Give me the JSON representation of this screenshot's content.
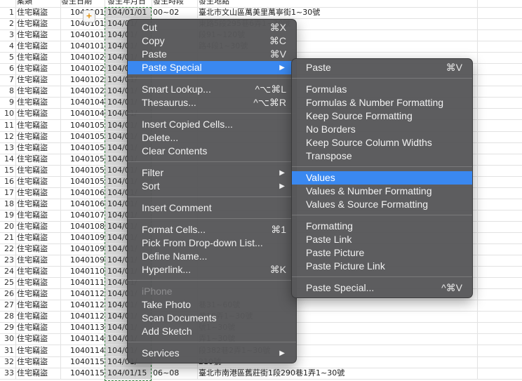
{
  "sheet": {
    "headers": [
      "案類",
      "發生日期",
      "發生年月日",
      "發生時段",
      "發生地點"
    ],
    "rows": [
      {
        "n": "1",
        "cat": "住宅竊盜",
        "date": "1040101",
        "ymd": "104/01/01",
        "time": "00~02",
        "addr": "臺北市文山區萬美里萬寧街1~30號"
      },
      {
        "n": "2",
        "cat": "住宅竊盜",
        "date": "1040101",
        "ymd": "104/01/",
        "time": "",
        "addr": "東路5段295巷6弄1~30號"
      },
      {
        "n": "3",
        "cat": "住宅竊盜",
        "date": "1040101",
        "ymd": "104/01/",
        "time": "",
        "addr": "段91~120號"
      },
      {
        "n": "4",
        "cat": "住宅竊盜",
        "date": "1040101",
        "ymd": "104/01/",
        "time": "",
        "addr": "路4段1~30號"
      },
      {
        "n": "5",
        "cat": "住宅竊盜",
        "date": "1040102",
        "ymd": "104/01/",
        "time": "",
        "addr": ""
      },
      {
        "n": "6",
        "cat": "住宅竊盜",
        "date": "1040102",
        "ymd": "104/01/",
        "time": "",
        "addr": ""
      },
      {
        "n": "7",
        "cat": "住宅竊盜",
        "date": "1040102",
        "ymd": "104/01/",
        "time": "",
        "addr": ""
      },
      {
        "n": "8",
        "cat": "住宅竊盜",
        "date": "1040102",
        "ymd": "104/01/",
        "time": "",
        "addr": ""
      },
      {
        "n": "9",
        "cat": "住宅竊盜",
        "date": "1040104",
        "ymd": "104/01/",
        "time": "",
        "addr": ""
      },
      {
        "n": "10",
        "cat": "住宅竊盜",
        "date": "1040104",
        "ymd": "104/01/",
        "time": "",
        "addr": ""
      },
      {
        "n": "11",
        "cat": "住宅竊盜",
        "date": "1040105",
        "ymd": "104/01/",
        "time": "",
        "addr": ""
      },
      {
        "n": "12",
        "cat": "住宅竊盜",
        "date": "1040105",
        "ymd": "104/01/",
        "time": "",
        "addr": ""
      },
      {
        "n": "13",
        "cat": "住宅竊盜",
        "date": "1040105",
        "ymd": "104/01/",
        "time": "",
        "addr": ""
      },
      {
        "n": "14",
        "cat": "住宅竊盜",
        "date": "1040105",
        "ymd": "104/01/",
        "time": "",
        "addr": ""
      },
      {
        "n": "15",
        "cat": "住宅竊盜",
        "date": "1040105",
        "ymd": "104/01/",
        "time": "",
        "addr": ""
      },
      {
        "n": "16",
        "cat": "住宅竊盜",
        "date": "1040105",
        "ymd": "104/01/",
        "time": "",
        "addr": ""
      },
      {
        "n": "17",
        "cat": "住宅竊盜",
        "date": "1040106",
        "ymd": "104/01/",
        "time": "",
        "addr": ""
      },
      {
        "n": "18",
        "cat": "住宅竊盜",
        "date": "1040106",
        "ymd": "104/01/",
        "time": "",
        "addr": ""
      },
      {
        "n": "19",
        "cat": "住宅竊盜",
        "date": "1040107",
        "ymd": "104/01/",
        "time": "",
        "addr": ""
      },
      {
        "n": "20",
        "cat": "住宅竊盜",
        "date": "1040108",
        "ymd": "104/01/",
        "time": "",
        "addr": ""
      },
      {
        "n": "21",
        "cat": "住宅竊盜",
        "date": "1040109",
        "ymd": "104/01/",
        "time": "",
        "addr": ""
      },
      {
        "n": "22",
        "cat": "住宅竊盜",
        "date": "1040109",
        "ymd": "104/01/",
        "time": "",
        "addr": ""
      },
      {
        "n": "23",
        "cat": "住宅竊盜",
        "date": "1040109",
        "ymd": "104/01/",
        "time": "",
        "addr": ""
      },
      {
        "n": "24",
        "cat": "住宅竊盜",
        "date": "1040110",
        "ymd": "104/01/",
        "time": "",
        "addr": ""
      },
      {
        "n": "25",
        "cat": "住宅竊盜",
        "date": "1040111",
        "ymd": "104/01/",
        "time": "",
        "addr": ""
      },
      {
        "n": "26",
        "cat": "住宅竊盜",
        "date": "1040112",
        "ymd": "104/01/",
        "time": "",
        "addr": ""
      },
      {
        "n": "27",
        "cat": "住宅竊盜",
        "date": "1040112",
        "ymd": "104/01/",
        "time": "",
        "addr": "巷31~60號"
      },
      {
        "n": "28",
        "cat": "住宅竊盜",
        "date": "1040112",
        "ymd": "104/01/",
        "time": "",
        "addr": "巷18弄1~30號"
      },
      {
        "n": "29",
        "cat": "住宅竊盜",
        "date": "1040113",
        "ymd": "104/01/",
        "time": "",
        "addr": "號1~30號"
      },
      {
        "n": "30",
        "cat": "住宅竊盜",
        "date": "1040114",
        "ymd": "104/01/",
        "time": "",
        "addr": "弄1~30號"
      },
      {
        "n": "31",
        "cat": "住宅竊盜",
        "date": "1040114",
        "ymd": "104/01/",
        "time": "",
        "addr": "段382巷2弄1~30號"
      },
      {
        "n": "32",
        "cat": "住宅竊盜",
        "date": "1040115",
        "ymd": "104/01/",
        "time": "",
        "addr": "210號"
      },
      {
        "n": "33",
        "cat": "住宅竊盜",
        "date": "1040115",
        "ymd": "104/01/15",
        "time": "06~08",
        "addr": "臺北市南港區舊莊街1段290巷1弄1~30號"
      }
    ]
  },
  "context_menu": {
    "items": [
      {
        "label": "Cut",
        "shortcut": "⌘X"
      },
      {
        "label": "Copy",
        "shortcut": "⌘C"
      },
      {
        "label": "Paste",
        "shortcut": "⌘V"
      },
      {
        "label": "Paste Special",
        "arrow": "▶",
        "highlighted": true
      },
      {
        "separator": true
      },
      {
        "label": "Smart Lookup...",
        "shortcut": "^⌥⌘L"
      },
      {
        "label": "Thesaurus...",
        "shortcut": "^⌥⌘R"
      },
      {
        "separator": true
      },
      {
        "label": "Insert Copied Cells..."
      },
      {
        "label": "Delete..."
      },
      {
        "label": "Clear Contents"
      },
      {
        "separator": true
      },
      {
        "label": "Filter",
        "arrow": "▶"
      },
      {
        "label": "Sort",
        "arrow": "▶"
      },
      {
        "separator": true
      },
      {
        "label": "Insert Comment"
      },
      {
        "separator": true
      },
      {
        "label": "Format Cells...",
        "shortcut": "⌘1"
      },
      {
        "label": "Pick From Drop-down List..."
      },
      {
        "label": "Define Name..."
      },
      {
        "label": "Hyperlink...",
        "shortcut": "⌘K"
      },
      {
        "separator": true
      },
      {
        "label": "iPhone",
        "disabled": true
      },
      {
        "label": "Take Photo"
      },
      {
        "label": "Scan Documents"
      },
      {
        "label": "Add Sketch"
      },
      {
        "separator": true
      },
      {
        "label": "Services",
        "arrow": "▶"
      }
    ]
  },
  "paste_special_menu": {
    "items": [
      {
        "label": "Paste",
        "shortcut": "⌘V"
      },
      {
        "separator": true
      },
      {
        "label": "Formulas"
      },
      {
        "label": "Formulas & Number Formatting"
      },
      {
        "label": "Keep Source Formatting"
      },
      {
        "label": "No Borders"
      },
      {
        "label": "Keep Source Column Widths"
      },
      {
        "label": "Transpose"
      },
      {
        "separator": true
      },
      {
        "label": "Values",
        "highlighted": true
      },
      {
        "label": "Values & Number Formatting"
      },
      {
        "label": "Values & Source Formatting"
      },
      {
        "separator": true
      },
      {
        "label": "Formatting"
      },
      {
        "label": "Paste Link"
      },
      {
        "label": "Paste Picture"
      },
      {
        "label": "Paste Picture Link"
      },
      {
        "separator": true
      },
      {
        "label": "Paste Special...",
        "shortcut": "^⌘V"
      }
    ]
  },
  "colors": {
    "highlight": "#3a88f0",
    "menu_bg": "#58585a",
    "selection_border": "#2f7d3a"
  }
}
